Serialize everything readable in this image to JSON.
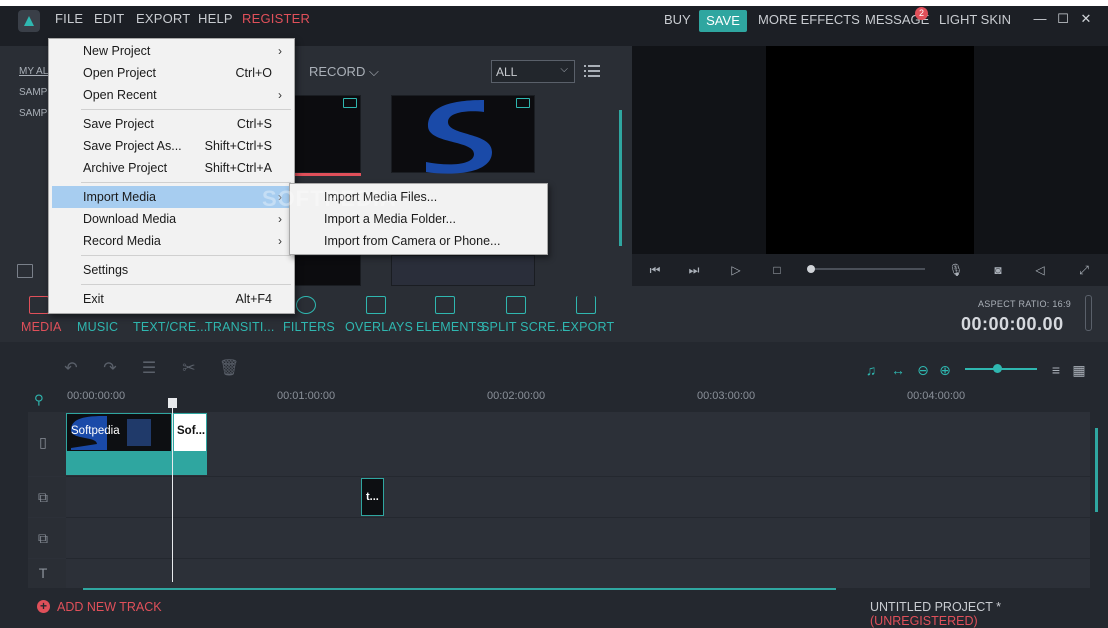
{
  "menubar": {
    "file": "FILE",
    "edit": "EDIT",
    "export": "EXPORT",
    "help": "HELP",
    "register": "REGISTER"
  },
  "topright": {
    "buy": "BUY",
    "save": "SAVE",
    "more_effects": "MORE EFFECTS",
    "message": "MESSAGE",
    "message_badge": "2",
    "light_skin": "LIGHT SKIN"
  },
  "library": {
    "side_items": [
      "MY AL",
      "SAMP",
      "SAMP"
    ],
    "record": "RECORD",
    "filter": "ALL"
  },
  "toolbar": {
    "items": [
      "MEDIA",
      "MUSIC",
      "TEXT/CRE...",
      "TRANSITI...",
      "FILTERS",
      "OVERLAYS",
      "ELEMENTS",
      "SPLIT SCRE...",
      "EXPORT"
    ],
    "aspect_ratio": "ASPECT RATIO: 16:9",
    "timecode": "00:00:00.00"
  },
  "timeline": {
    "ruler": [
      "00:00:00:00",
      "00:01:00:00",
      "00:02:00:00",
      "00:03:00:00",
      "00:04:00:00"
    ],
    "clip1_label": "Softpedia",
    "clip2_label": "Sof...",
    "clip3_label": "t..."
  },
  "bottom": {
    "add_track": "ADD NEW TRACK",
    "project": "UNTITLED PROJECT *",
    "unregistered": "(UNREGISTERED)"
  },
  "file_menu": {
    "new_project": "New Project",
    "open_project": "Open Project",
    "open_project_sc": "Ctrl+O",
    "open_recent": "Open Recent",
    "save_project": "Save Project",
    "save_project_sc": "Ctrl+S",
    "save_as": "Save Project As...",
    "save_as_sc": "Shift+Ctrl+S",
    "archive": "Archive Project",
    "archive_sc": "Shift+Ctrl+A",
    "import_media": "Import Media",
    "download_media": "Download Media",
    "record_media": "Record Media",
    "settings": "Settings",
    "exit": "Exit",
    "exit_sc": "Alt+F4"
  },
  "import_submenu": {
    "files": "Import Media Files...",
    "folder": "Import a Media Folder...",
    "camera": "Import from Camera or Phone..."
  },
  "watermark": "SOFTPEDIA"
}
